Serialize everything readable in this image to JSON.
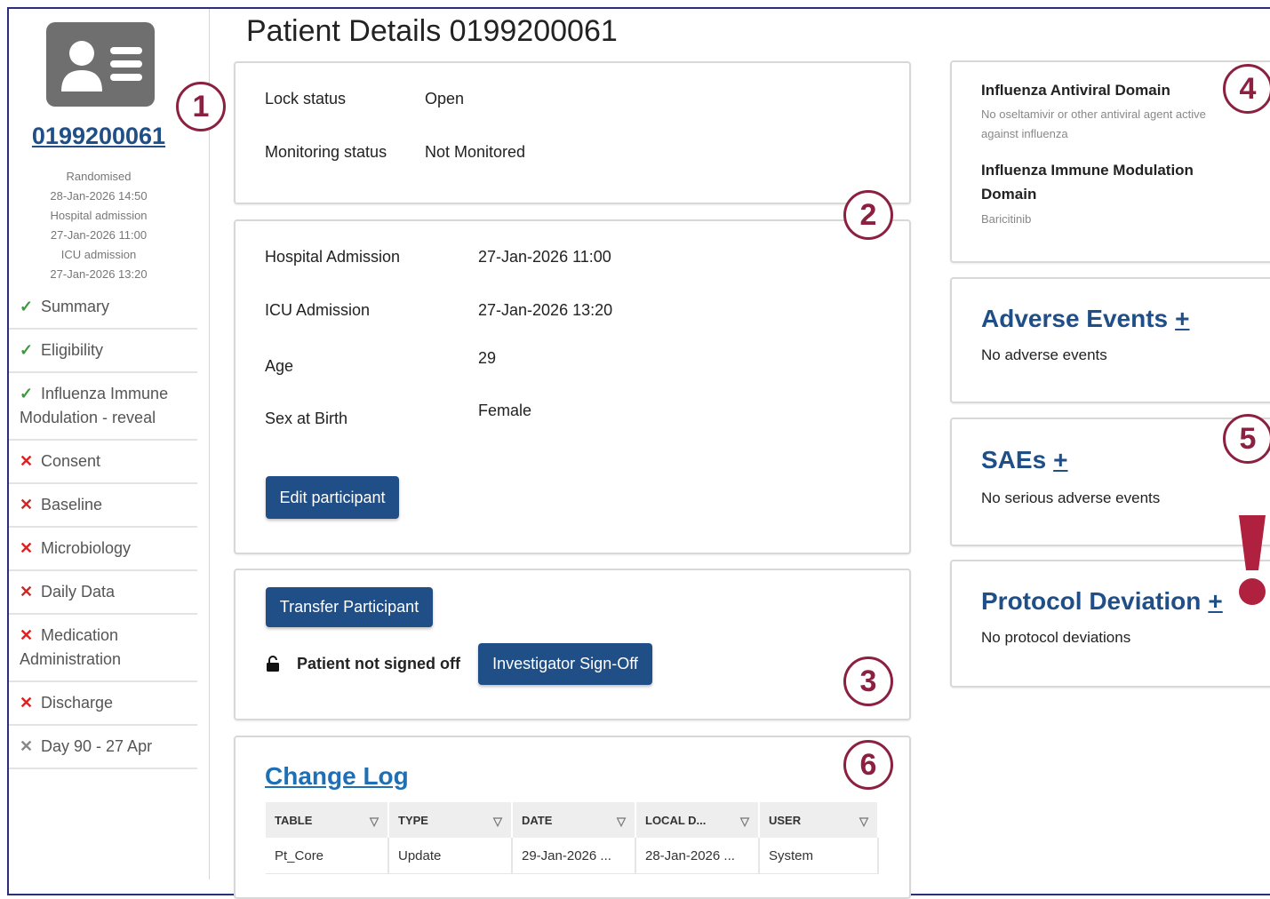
{
  "patient": {
    "title": "Patient Details 0199200061",
    "id": "0199200061",
    "meta": [
      "Randomised",
      "28-Jan-2026 14:50",
      "Hospital admission",
      "27-Jan-2026 11:00",
      "ICU admission",
      "27-Jan-2026 13:20"
    ]
  },
  "nav": [
    {
      "status": "ok",
      "icon": "check-icon",
      "label": "Summary"
    },
    {
      "status": "ok",
      "icon": "check-icon",
      "label": "Eligibility"
    },
    {
      "status": "ok",
      "icon": "check-icon",
      "label": "Influenza Immune Modulation - reveal"
    },
    {
      "status": "bad",
      "icon": "cross-icon",
      "label": "Consent"
    },
    {
      "status": "bad",
      "icon": "cross-icon",
      "label": "Baseline"
    },
    {
      "status": "bad",
      "icon": "cross-icon",
      "label": "Microbiology"
    },
    {
      "status": "bad",
      "icon": "cross-icon",
      "label": "Daily Data"
    },
    {
      "status": "bad",
      "icon": "cross-icon",
      "label": "Medication Administration"
    },
    {
      "status": "bad",
      "icon": "cross-icon",
      "label": "Discharge"
    },
    {
      "status": "grey",
      "icon": "cross-icon",
      "label": "Day 90 - 27 Apr"
    }
  ],
  "status_card": {
    "lock_label": "Lock status",
    "lock_value": "Open",
    "monitor_label": "Monitoring status",
    "monitor_value": "Not Monitored"
  },
  "details_card": {
    "hosp_label": "Hospital Admission",
    "hosp_value": "27-Jan-2026 11:00",
    "icu_label": "ICU Admission",
    "icu_value": "27-Jan-2026 13:20",
    "age_label": "Age",
    "age_value": "29",
    "sex_label": "Sex at Birth",
    "sex_value": "Female",
    "edit_button": "Edit participant"
  },
  "actions_card": {
    "transfer_button": "Transfer Participant",
    "signoff_status": "Patient not signed off",
    "signoff_button": "Investigator Sign-Off"
  },
  "change_log": {
    "heading": "Change Log",
    "columns": [
      "TABLE",
      "TYPE",
      "DATE",
      "LOCAL D...",
      "USER"
    ],
    "rows": [
      [
        "Pt_Core",
        "Update",
        "29-Jan-2026 ...",
        "28-Jan-2026 ...",
        "System"
      ]
    ]
  },
  "domains": {
    "d1_title": "Influenza Antiviral Domain",
    "d1_desc": "No oseltamivir or other antiviral agent active against influenza",
    "d2_title": "Influenza Immune Modulation Domain",
    "d2_desc": "Baricitinib"
  },
  "adverse": {
    "heading": "Adverse Events",
    "plus": "+",
    "text": "No adverse events"
  },
  "saes": {
    "heading": "SAEs",
    "plus": "+",
    "text": "No serious adverse events"
  },
  "protocol": {
    "heading": "Protocol Deviation",
    "plus": "+",
    "text": "No protocol deviations"
  },
  "callouts": [
    "1",
    "2",
    "3",
    "4",
    "5",
    "6"
  ],
  "colors": {
    "brand": "#1f4f86",
    "callout": "#8b2040",
    "ok": "#3c9a3c",
    "bad": "#d82323"
  }
}
